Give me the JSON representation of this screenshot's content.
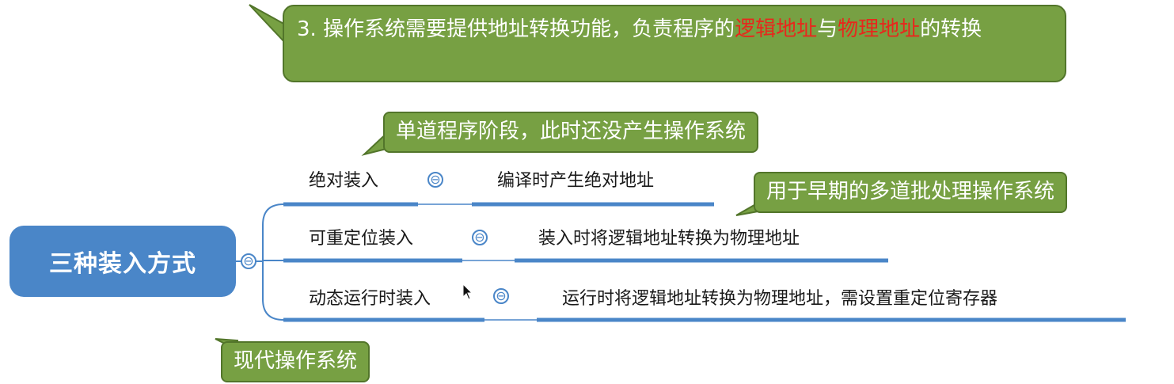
{
  "callouts": {
    "main_prefix": "3. 操作系统需要提供地址转换功能，负责程序的",
    "main_red1": "逻辑地址",
    "main_mid": "与",
    "main_red2": "物理地址",
    "main_suffix": "的转换",
    "single_program": "单道程序阶段，此时还没产生操作系统",
    "early_multi": "用于早期的多道批处理操作系统",
    "modern": "现代操作系统"
  },
  "root": {
    "label": "三种装入方式"
  },
  "branches": [
    {
      "label": "绝对装入",
      "detail": "编译时产生绝对地址"
    },
    {
      "label": "可重定位装入",
      "detail": "装入时将逻辑地址转换为物理地址"
    },
    {
      "label": "动态运行时装入",
      "detail": "运行时将逻辑地址转换为物理地址，需设置重定位寄存器"
    }
  ],
  "toggle_symbol": "⊖",
  "colors": {
    "callout_fill": "#77a043",
    "callout_border": "#52752a",
    "root_fill": "#4a86c8",
    "line_blue": "#4a86c8",
    "highlight_red": "#e8271c"
  }
}
